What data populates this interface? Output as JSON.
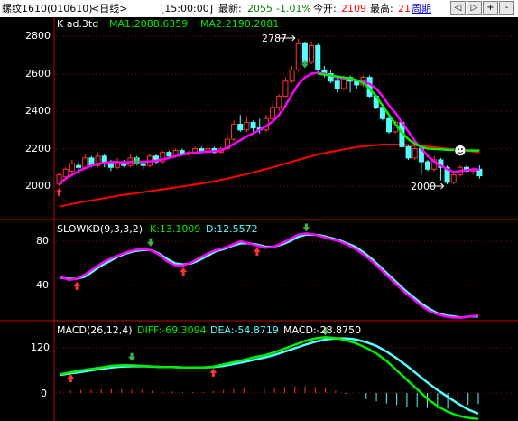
{
  "topbar": {
    "symbol": "螺纹1610",
    "code": "(010610)",
    "period": "<日线>",
    "time": "[15:00:00]",
    "latest_label": "最新:",
    "latest_value": "2055",
    "change_pct": "-1.01%",
    "open_label": "今开:",
    "open_value": "2109",
    "high_label": "最高:",
    "high_value": "21",
    "cycle_link": "周期",
    "nav_buttons": [
      "◁",
      "▷",
      "+",
      "-"
    ]
  },
  "colors": {
    "up": "#ff3232",
    "down": "#54ffff",
    "ma1": "#ff00ff",
    "ma2": "#00ee00",
    "ma_long": "#ff0000",
    "k_line": "#e8e8e8",
    "grid": "#8b0000",
    "frame": "#c00000"
  },
  "price_panel": {
    "title": "K ad.3td",
    "ma1_label": "MA1:2088.6359",
    "ma2_label": "MA2:2190.2081",
    "y_ticks": [
      "2800",
      "2600",
      "2400",
      "2200",
      "2000"
    ],
    "annot_high": "2787",
    "annot_low": "2000"
  },
  "kd_panel": {
    "title": "SLOWKD(9,3,3,2)",
    "k_label": "K:13.1009",
    "d_label": "D:12.5572",
    "y_ticks": [
      "80",
      "40"
    ]
  },
  "macd_panel": {
    "title": "MACD(26,12,4)",
    "diff_label": "DIFF:-69.3094",
    "dea_label": "DEA:-54.8719",
    "macd_label": "MACD:-28.8750",
    "y_ticks": [
      "120",
      "0"
    ]
  },
  "chart_data": [
    {
      "type": "candlestick",
      "y_ticks": [
        2800,
        2600,
        2400,
        2200,
        2000
      ],
      "series": [
        {
          "name": "K",
          "ohlc": [
            [
              2010,
              2060,
              2000,
              2070
            ],
            [
              2050,
              2090,
              2040,
              2100
            ],
            [
              2080,
              2120,
              2060,
              2140
            ],
            [
              2110,
              2100,
              2080,
              2130
            ],
            [
              2100,
              2150,
              2090,
              2170
            ],
            [
              2150,
              2110,
              2100,
              2160
            ],
            [
              2110,
              2160,
              2100,
              2180
            ],
            [
              2160,
              2120,
              2100,
              2170
            ],
            [
              2120,
              2100,
              2080,
              2140
            ],
            [
              2100,
              2130,
              2090,
              2150
            ],
            [
              2130,
              2110,
              2100,
              2140
            ],
            [
              2110,
              2150,
              2100,
              2170
            ],
            [
              2150,
              2120,
              2110,
              2160
            ],
            [
              2120,
              2110,
              2090,
              2130
            ],
            [
              2110,
              2160,
              2100,
              2170
            ],
            [
              2160,
              2130,
              2120,
              2170
            ],
            [
              2130,
              2180,
              2120,
              2190
            ],
            [
              2180,
              2160,
              2150,
              2190
            ],
            [
              2160,
              2190,
              2150,
              2200
            ],
            [
              2190,
              2170,
              2160,
              2200
            ],
            [
              2170,
              2180,
              2160,
              2190
            ],
            [
              2180,
              2200,
              2170,
              2210
            ],
            [
              2200,
              2180,
              2170,
              2210
            ],
            [
              2180,
              2200,
              2170,
              2220
            ],
            [
              2200,
              2180,
              2170,
              2210
            ],
            [
              2180,
              2200,
              2170,
              2210
            ],
            [
              2200,
              2250,
              2190,
              2280
            ],
            [
              2250,
              2330,
              2240,
              2350
            ],
            [
              2330,
              2300,
              2290,
              2380
            ],
            [
              2300,
              2340,
              2290,
              2370
            ],
            [
              2340,
              2310,
              2290,
              2350
            ],
            [
              2310,
              2300,
              2280,
              2360
            ],
            [
              2300,
              2360,
              2290,
              2380
            ],
            [
              2360,
              2420,
              2350,
              2440
            ],
            [
              2420,
              2480,
              2400,
              2490
            ],
            [
              2480,
              2560,
              2470,
              2580
            ],
            [
              2560,
              2620,
              2550,
              2640
            ],
            [
              2620,
              2760,
              2610,
              2787
            ],
            [
              2760,
              2660,
              2640,
              2770
            ],
            [
              2660,
              2750,
              2650,
              2770
            ],
            [
              2750,
              2620,
              2600,
              2760
            ],
            [
              2620,
              2600,
              2580,
              2640
            ],
            [
              2600,
              2560,
              2550,
              2620
            ],
            [
              2560,
              2520,
              2500,
              2580
            ],
            [
              2520,
              2580,
              2510,
              2590
            ],
            [
              2580,
              2560,
              2500,
              2590
            ],
            [
              2560,
              2540,
              2520,
              2570
            ],
            [
              2540,
              2580,
              2530,
              2590
            ],
            [
              2580,
              2480,
              2470,
              2590
            ],
            [
              2480,
              2420,
              2410,
              2490
            ],
            [
              2420,
              2360,
              2350,
              2440
            ],
            [
              2360,
              2290,
              2280,
              2380
            ],
            [
              2290,
              2340,
              2280,
              2350
            ],
            [
              2340,
              2210,
              2200,
              2350
            ],
            [
              2210,
              2150,
              2140,
              2220
            ],
            [
              2150,
              2200,
              2140,
              2220
            ],
            [
              2200,
              2130,
              2060,
              2210
            ],
            [
              2130,
              2090,
              2080,
              2140
            ],
            [
              2090,
              2140,
              2080,
              2160
            ],
            [
              2140,
              2100,
              2030,
              2150
            ],
            [
              2100,
              2020,
              2010,
              2110
            ],
            [
              2020,
              2060,
              2010,
              2070
            ],
            [
              2060,
              2100,
              2050,
              2110
            ],
            [
              2100,
              2080,
              2070,
              2110
            ],
            [
              2080,
              2090,
              2060,
              2100
            ],
            [
              2090,
              2055,
              2040,
              2110
            ]
          ]
        },
        {
          "name": "MA1",
          "values": [
            2010,
            2040,
            2060,
            2080,
            2095,
            2110,
            2118,
            2125,
            2128,
            2128,
            2126,
            2128,
            2130,
            2130,
            2132,
            2136,
            2142,
            2150,
            2160,
            2168,
            2174,
            2178,
            2182,
            2184,
            2186,
            2190,
            2205,
            2225,
            2245,
            2265,
            2282,
            2300,
            2320,
            2345,
            2380,
            2430,
            2490,
            2545,
            2580,
            2600,
            2605,
            2600,
            2590,
            2580,
            2575,
            2570,
            2565,
            2560,
            2545,
            2520,
            2480,
            2430,
            2390,
            2340,
            2290,
            2240,
            2200,
            2160,
            2130,
            2110,
            2090,
            2075,
            2080,
            2085,
            2090,
            2088
          ]
        },
        {
          "name": "MA2",
          "values": [
            null,
            null,
            null,
            null,
            null,
            null,
            null,
            null,
            null,
            null,
            null,
            null,
            null,
            null,
            null,
            null,
            null,
            null,
            null,
            null,
            null,
            null,
            null,
            null,
            null,
            null,
            null,
            null,
            null,
            null,
            null,
            null,
            null,
            null,
            null,
            null,
            null,
            null,
            null,
            null,
            2600,
            2595,
            2590,
            2585,
            2580,
            2575,
            2565,
            2550,
            2520,
            2480,
            2430,
            2380,
            2330,
            2285,
            2250,
            2225,
            2210,
            2200,
            2198,
            2196,
            2194,
            2193,
            2192,
            2191,
            2190,
            2190
          ]
        },
        {
          "name": "MA_LONG",
          "values": [
            1890,
            1898,
            1905,
            1912,
            1918,
            1924,
            1930,
            1936,
            1942,
            1948,
            1953,
            1958,
            1963,
            1968,
            1973,
            1978,
            1983,
            1988,
            1993,
            1998,
            2003,
            2008,
            2014,
            2020,
            2026,
            2033,
            2040,
            2048,
            2056,
            2064,
            2073,
            2082,
            2091,
            2100,
            2110,
            2120,
            2130,
            2140,
            2150,
            2160,
            2168,
            2176,
            2183,
            2190,
            2196,
            2202,
            2208,
            2212,
            2216,
            2219,
            2221,
            2222,
            2222,
            2221,
            2219,
            2217,
            2215,
            2212,
            2208,
            2204,
            2200,
            2196,
            2192,
            2188,
            2184,
            2180
          ]
        }
      ]
    },
    {
      "type": "line",
      "y_ticks": [
        80,
        40
      ],
      "series": [
        {
          "name": "K",
          "values": [
            48,
            45,
            46,
            50,
            55,
            60,
            64,
            67,
            70,
            72,
            73,
            72,
            68,
            62,
            58,
            58,
            61,
            65,
            69,
            72,
            74,
            77,
            80,
            78,
            76,
            74,
            75,
            78,
            82,
            86,
            87,
            86,
            84,
            82,
            80,
            77,
            73,
            68,
            62,
            55,
            48,
            41,
            34,
            28,
            22,
            17,
            14,
            12,
            11,
            11,
            12,
            13
          ]
        },
        {
          "name": "D",
          "values": [
            47,
            46,
            46,
            48,
            53,
            58,
            62,
            66,
            69,
            71,
            72,
            72,
            69,
            64,
            60,
            59,
            60,
            63,
            67,
            71,
            73,
            76,
            78,
            78,
            77,
            75,
            75,
            77,
            80,
            84,
            86,
            86,
            85,
            83,
            81,
            78,
            75,
            70,
            64,
            57,
            50,
            43,
            36,
            30,
            24,
            19,
            15,
            13,
            12,
            11,
            12,
            12
          ]
        }
      ]
    },
    {
      "type": "line",
      "y_ticks": [
        120,
        0
      ],
      "series": [
        {
          "name": "DIFF",
          "values": [
            50,
            55,
            60,
            64,
            68,
            72,
            74,
            74,
            72,
            70,
            69,
            69,
            68,
            68,
            68,
            70,
            76,
            82,
            88,
            95,
            100,
            108,
            118,
            128,
            138,
            145,
            148,
            146,
            140,
            132,
            120,
            105,
            85,
            60,
            35,
            10,
            -15,
            -35,
            -50,
            -60,
            -66,
            -69
          ]
        },
        {
          "name": "DEA",
          "values": [
            48,
            52,
            56,
            60,
            64,
            68,
            70,
            71,
            71,
            70,
            69,
            69,
            68,
            68,
            68,
            69,
            72,
            77,
            82,
            88,
            94,
            101,
            110,
            119,
            128,
            136,
            142,
            145,
            145,
            142,
            135,
            125,
            110,
            92,
            72,
            50,
            28,
            8,
            -10,
            -28,
            -44,
            -55
          ]
        },
        {
          "name": "MACD",
          "values": [
            5,
            6,
            8,
            9,
            10,
            10,
            10,
            9,
            8,
            6,
            5,
            4,
            3,
            3,
            3,
            5,
            8,
            10,
            12,
            14,
            14,
            14,
            16,
            18,
            18,
            16,
            12,
            6,
            -2,
            -8,
            -16,
            -22,
            -28,
            -32,
            -36,
            -38,
            -40,
            -42,
            -42,
            -36,
            -32,
            -29
          ]
        }
      ]
    }
  ]
}
